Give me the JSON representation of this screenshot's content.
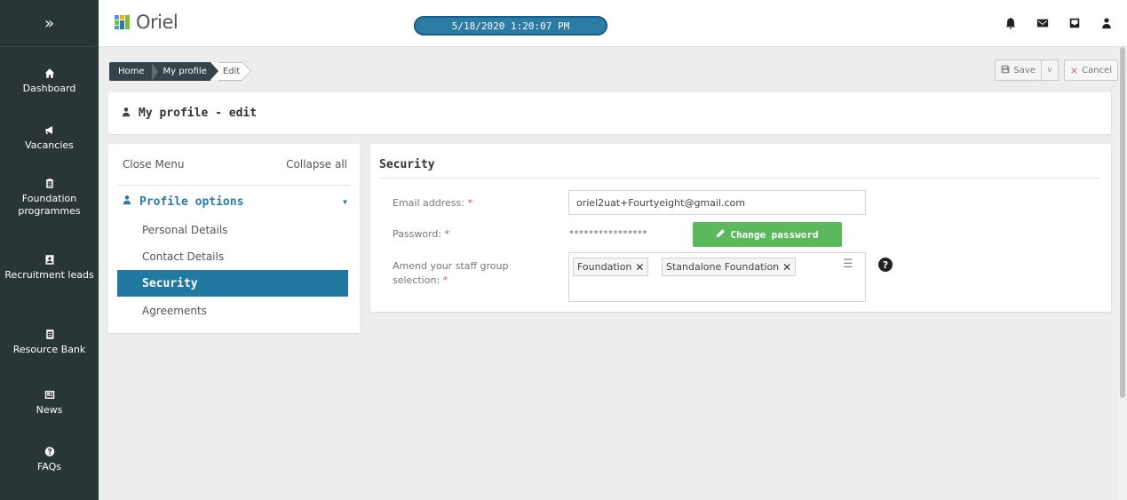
{
  "sidebar": {
    "toggle_icon": "double-chevron-right-icon",
    "toggle_glyph": "»",
    "items": [
      {
        "label": "Dashboard",
        "icon": "home-icon"
      },
      {
        "label": "Vacancies",
        "icon": "megaphone-icon"
      },
      {
        "label": "Foundation programmes",
        "icon": "clipboard-icon"
      },
      {
        "label": "Recruitment leads",
        "icon": "id-card-icon"
      },
      {
        "label": "Resource Bank",
        "icon": "book-icon"
      },
      {
        "label": "News",
        "icon": "newspaper-icon"
      },
      {
        "label": "FAQs",
        "icon": "question-icon"
      }
    ]
  },
  "header": {
    "logo_text": "Oriel",
    "datetime": "5/18/2020 1:20:07 PM",
    "icons": [
      "bell-icon",
      "envelope-icon",
      "inbox-icon",
      "user-icon"
    ]
  },
  "breadcrumb": {
    "home": "Home",
    "profile": "My profile",
    "current": "Edit"
  },
  "toolbar": {
    "save_label": "Save",
    "cancel_label": "Cancel"
  },
  "page": {
    "title": "My profile - edit"
  },
  "menu": {
    "close_label": "Close Menu",
    "collapse_label": "Collapse all",
    "group_label": "Profile options",
    "items": [
      {
        "label": "Personal Details",
        "active": false
      },
      {
        "label": "Contact Details",
        "active": false
      },
      {
        "label": "Security",
        "active": true
      },
      {
        "label": "Agreements",
        "active": false
      }
    ]
  },
  "security": {
    "title": "Security",
    "email_label": "Email address:",
    "email_value": "oriel2uat+Fourtyeight@gmail.com",
    "password_label": "Password:",
    "password_mask": "****************",
    "change_password_label": "Change password",
    "staff_group_label_line1": "Amend your staff group",
    "staff_group_label_line2": "selection:",
    "required_mark": "*",
    "staff_groups": [
      "Foundation",
      "Standalone Foundation"
    ],
    "help_glyph": "?"
  },
  "colors": {
    "sidebar_bg": "#2a3538",
    "accent": "#2178a0",
    "success": "#5cb85c",
    "required": "#d9534f"
  }
}
